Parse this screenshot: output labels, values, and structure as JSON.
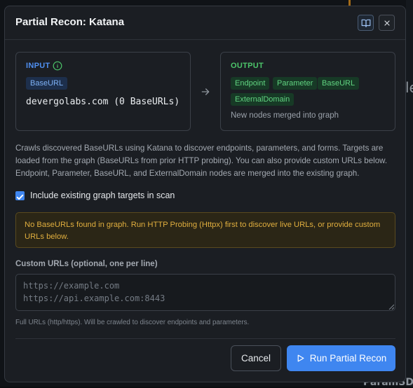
{
  "background": {
    "right_text": "le",
    "bottom_text": "ParamSD"
  },
  "modal": {
    "title": "Partial Recon: Katana",
    "header_icons": [
      "book-open-icon",
      "close-icon"
    ]
  },
  "input": {
    "label": "INPUT",
    "chip": "BaseURL",
    "value": "devergolabs.com (0 BaseURLs)"
  },
  "output": {
    "label": "OUTPUT",
    "chips": [
      "Endpoint",
      "Parameter",
      "BaseURL",
      "ExternalDomain"
    ],
    "note": "New nodes merged into graph"
  },
  "description": "Crawls discovered BaseURLs using Katana to discover endpoints, parameters, and forms. Targets are loaded from the graph (BaseURLs from prior HTTP probing). You can also provide custom URLs below. Endpoint, Parameter, BaseURL, and ExternalDomain nodes are merged into the existing graph.",
  "include_targets": {
    "label": "Include existing graph targets in scan",
    "checked": true
  },
  "warning": "No BaseURLs found in graph. Run HTTP Probing (Httpx) first to discover live URLs, or provide custom URLs below.",
  "custom_urls": {
    "label": "Custom URLs (optional, one per line)",
    "placeholder": "https://example.com\nhttps://api.example.com:8443",
    "value": "",
    "hint": "Full URLs (http/https). Will be crawled to discover endpoints and parameters."
  },
  "buttons": {
    "cancel": "Cancel",
    "run": "Run Partial Recon"
  },
  "colors": {
    "accent": "#3f86f0",
    "input_label": "#4f8ff0",
    "output_label": "#4cc56a",
    "warning_text": "#e0ae3e"
  }
}
